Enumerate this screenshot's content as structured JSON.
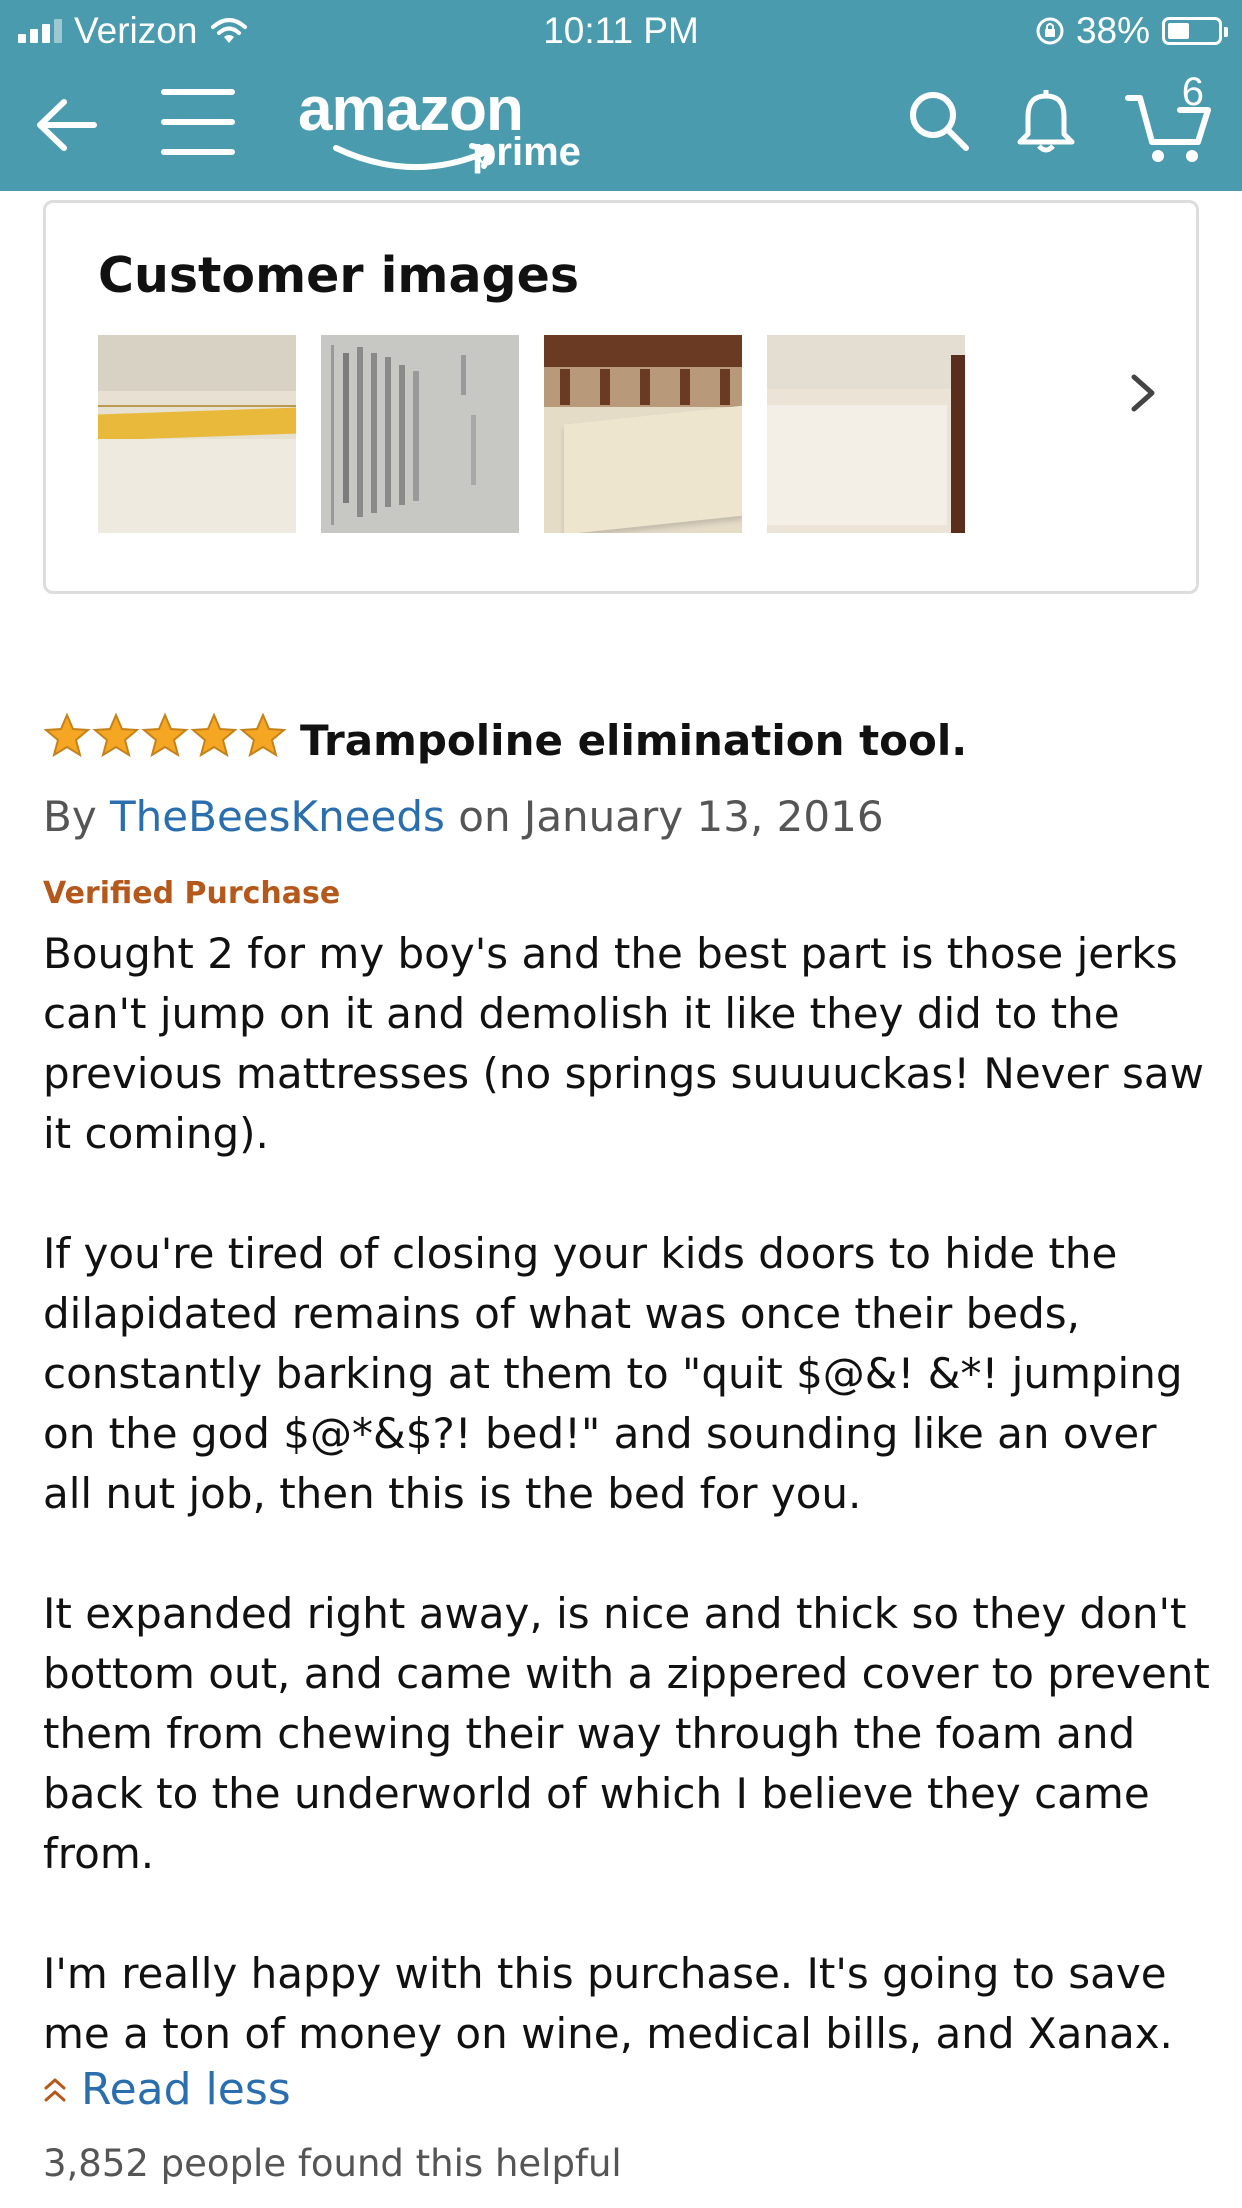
{
  "status_bar": {
    "carrier": "Verizon",
    "time": "10:11 PM",
    "battery": "38%"
  },
  "header": {
    "logo_text": "amazon",
    "logo_sub": "prime",
    "cart_count": "6",
    "icons": [
      "back-arrow-icon",
      "menu-icon",
      "search-icon",
      "bell-icon",
      "cart-icon"
    ],
    "color": "#4b9bae"
  },
  "customer_images": {
    "title": "Customer images",
    "thumbnails": [
      "ruler-on-foam-photo",
      "shipping-label-photo",
      "mattress-in-bed-photo",
      "mattress-wrapped-photo"
    ]
  },
  "review": {
    "rating": 5,
    "title": "Trampoline elimination tool.",
    "by_prefix": "By",
    "author": "TheBeesKneeds",
    "date": "on January 13, 2016",
    "verified": "Verified Purchase",
    "paragraphs": [
      "Bought 2 for my boy's and the best part is those jerks can't jump on it and demolish it like they did to the previous mattresses (no springs suuuuckas! Never saw it coming).",
      "If you're tired of closing your kids doors to hide the dilapidated remains of what was once their beds, constantly barking at them to \"quit $@&! &*! jumping on the god $@*&$?! bed!\" and sounding like an over all nut job, then this is the bed for you.",
      "It expanded right away, is nice and thick so they don't bottom out, and came with a zippered cover to prevent them from chewing their way through the foam and back to the underworld of which I believe they came from.",
      "I'm really happy with this purchase. It's going to save me a ton of money on wine, medical bills, and Xanax."
    ],
    "read_less": "Read less",
    "helpful": "3,852 people found this helpful"
  },
  "colors": {
    "link": "#2a6ead",
    "verified": "#b5581b",
    "star": "#f5a623"
  }
}
